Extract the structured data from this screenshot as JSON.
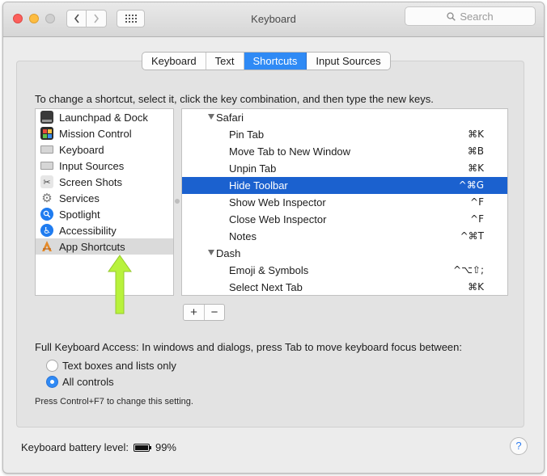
{
  "window": {
    "title": "Keyboard",
    "search_placeholder": "Search"
  },
  "tabs": [
    {
      "label": "Keyboard",
      "active": false
    },
    {
      "label": "Text",
      "active": false
    },
    {
      "label": "Shortcuts",
      "active": true
    },
    {
      "label": "Input Sources",
      "active": false
    }
  ],
  "instructions": "To change a shortcut, select it, click the key combination, and then type the new keys.",
  "categories": [
    {
      "label": "Launchpad & Dock",
      "icon": "launchpad-dock-icon"
    },
    {
      "label": "Mission Control",
      "icon": "mission-control-icon"
    },
    {
      "label": "Keyboard",
      "icon": "keyboard-icon"
    },
    {
      "label": "Input Sources",
      "icon": "input-sources-icon"
    },
    {
      "label": "Screen Shots",
      "icon": "screenshot-icon"
    },
    {
      "label": "Services",
      "icon": "gear-icon"
    },
    {
      "label": "Spotlight",
      "icon": "spotlight-icon"
    },
    {
      "label": "Accessibility",
      "icon": "accessibility-icon"
    },
    {
      "label": "App Shortcuts",
      "icon": "app-shortcuts-icon",
      "selected": true
    }
  ],
  "shortcuts": {
    "groups": [
      {
        "app": "Safari",
        "items": [
          {
            "name": "Pin Tab",
            "keys": "⌘K"
          },
          {
            "name": "Move Tab to New Window",
            "keys": "⌘B"
          },
          {
            "name": "Unpin Tab",
            "keys": "⌘K"
          },
          {
            "name": "Hide Toolbar",
            "keys": "^⌘G",
            "selected": true
          },
          {
            "name": "Show Web Inspector",
            "keys": "^F"
          },
          {
            "name": "Close Web Inspector",
            "keys": "^F"
          },
          {
            "name": "Notes",
            "keys": "^⌘T"
          }
        ]
      },
      {
        "app": "Dash",
        "items": [
          {
            "name": "Emoji & Symbols",
            "keys": "^⌥⇧;"
          },
          {
            "name": "Select Next Tab",
            "keys": "⌘K"
          }
        ]
      }
    ]
  },
  "buttons": {
    "add": "+",
    "remove": "−"
  },
  "full_keyboard_access": {
    "label": "Full Keyboard Access: In windows and dialogs, press Tab to move keyboard focus between:",
    "options": [
      {
        "label": "Text boxes and lists only",
        "selected": false
      },
      {
        "label": "All controls",
        "selected": true
      }
    ],
    "note": "Press Control+F7 to change this setting."
  },
  "battery": {
    "label": "Keyboard battery level:",
    "value": "99%",
    "level": 0.99
  },
  "help": "?",
  "colors": {
    "accent": "#2f8af5",
    "selection": "#1b61cf",
    "arrow": "#b8f23c"
  }
}
